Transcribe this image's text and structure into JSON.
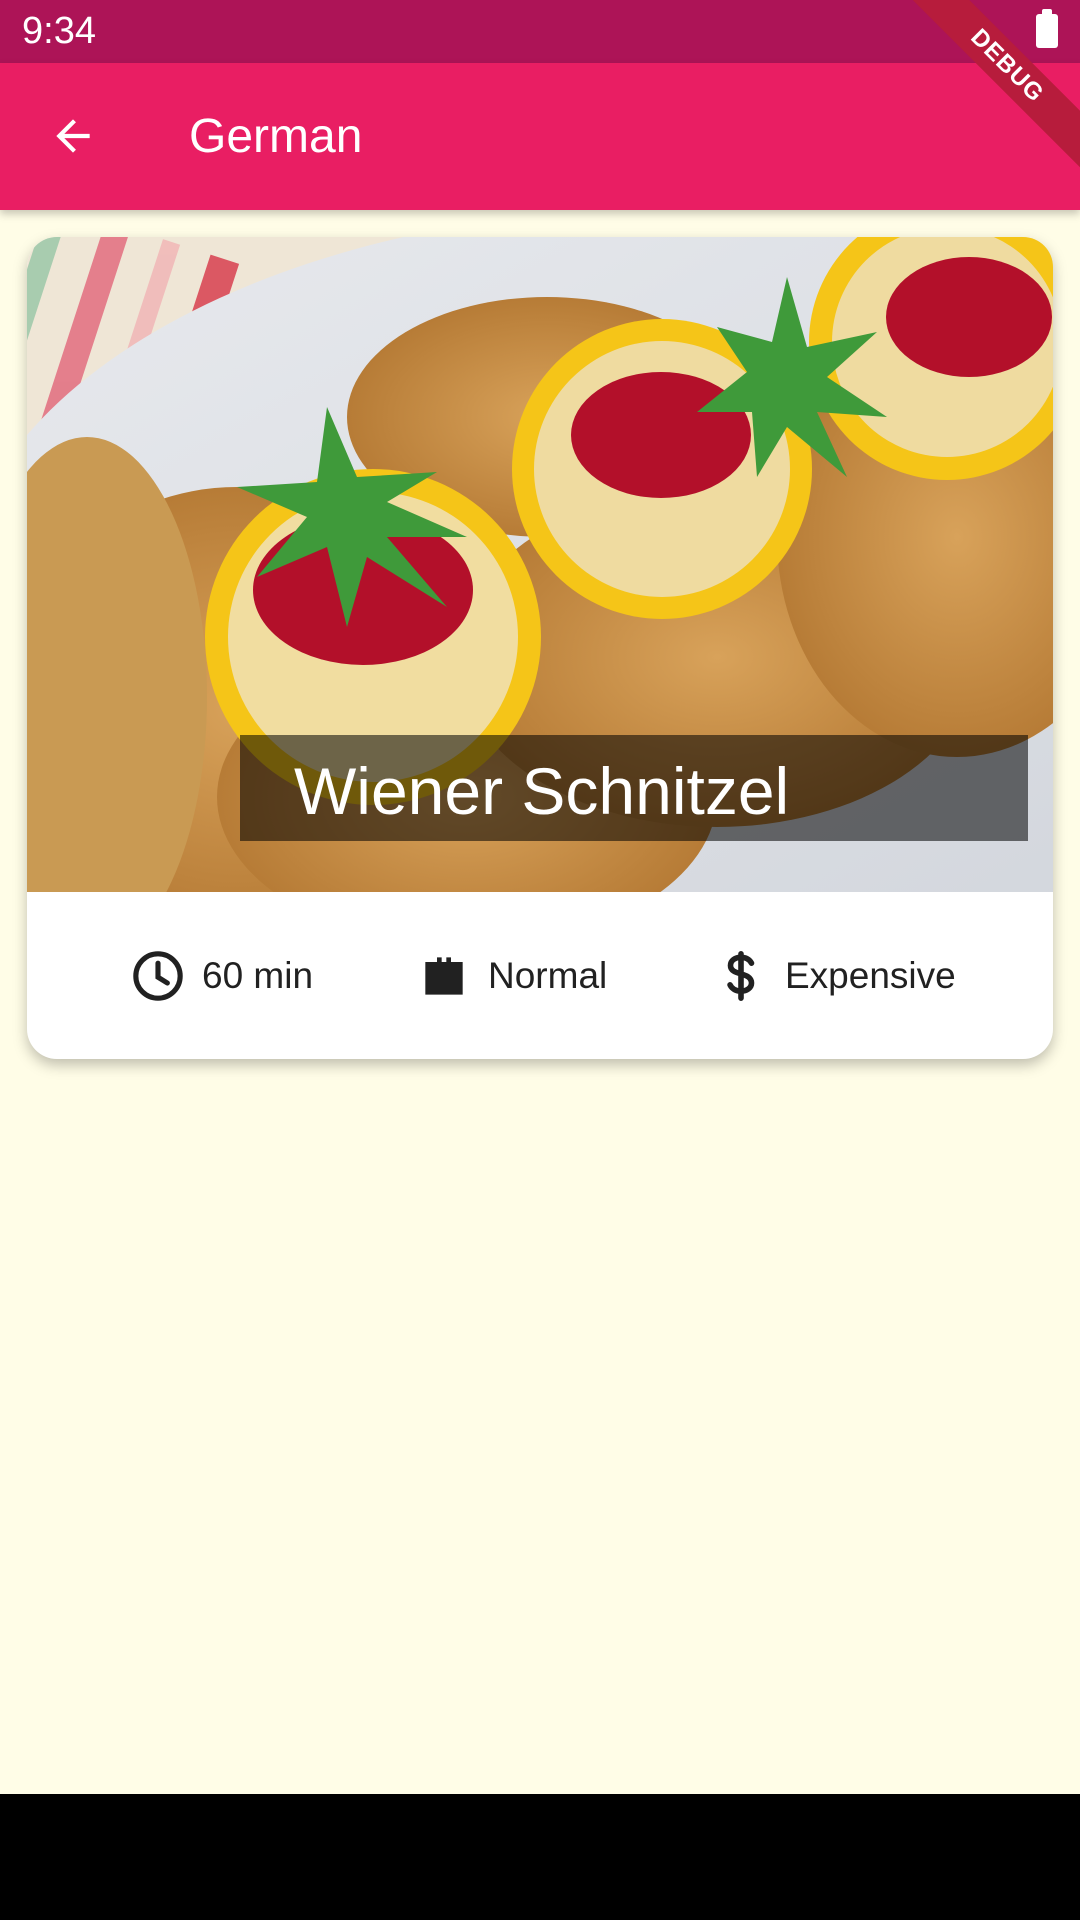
{
  "status_bar": {
    "time": "9:34"
  },
  "app_bar": {
    "title": "German"
  },
  "debug_banner": {
    "label": "DEBUG"
  },
  "recipe": {
    "title": "Wiener Schnitzel",
    "duration": "60 min",
    "complexity": "Normal",
    "affordability": "Expensive"
  },
  "icons": {
    "back": "arrow-left",
    "duration": "clock-icon",
    "complexity": "briefcase-icon",
    "affordability": "dollar-sign"
  },
  "colors": {
    "primary": "#e91e63",
    "primary_dark": "#ad1457",
    "background": "#fffde7",
    "card": "#ffffff"
  }
}
